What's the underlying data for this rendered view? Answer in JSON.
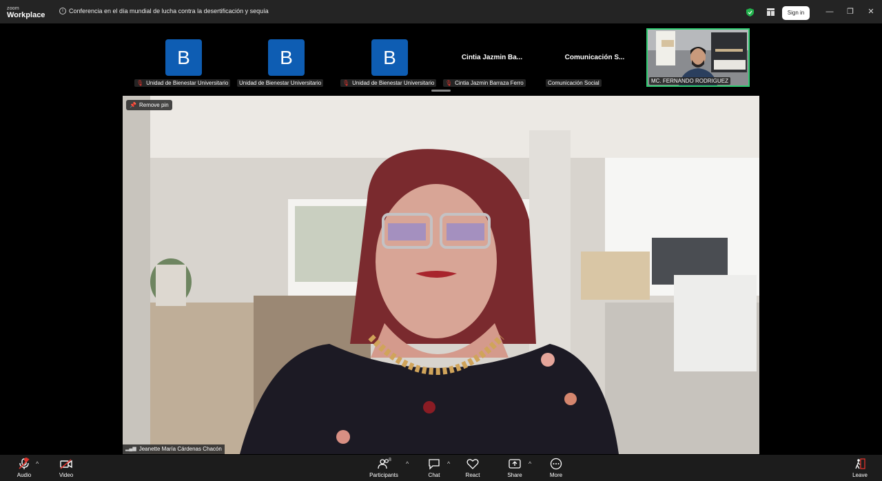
{
  "app": {
    "logo_line1": "zoom",
    "logo_line2": "Workplace"
  },
  "meeting": {
    "title": "Conferencia en el día mundial de lucha contra la desertificación y sequía"
  },
  "titlebar": {
    "signin_label": "Sign in",
    "minimize": "—",
    "restore": "❐",
    "close": "✕"
  },
  "strip": {
    "tiles": [
      {
        "avatar_letter": "B",
        "label": "Unidad de Bienestar Universitario"
      },
      {
        "avatar_letter": "B",
        "label": "Unidad de Bienestar Universitario"
      },
      {
        "avatar_letter": "B",
        "label": "Unidad de Bienestar Universitario"
      },
      {
        "name": "Cintia Jazmin Ba...",
        "label": "Cintia Jazmin Barraza Ferro"
      },
      {
        "name": "Comunicación S...",
        "label": "Comunicación Social"
      },
      {
        "label": "MC. FERNANDO RODRIGUEZ"
      }
    ]
  },
  "main_video": {
    "pin_label": "Remove pin",
    "speaker_name": "Jeanette María Cárdenas Chacón"
  },
  "toolbar": {
    "audio": "Audio",
    "video": "Video",
    "participants": "Participants",
    "participant_count": "8",
    "chat": "Chat",
    "react": "React",
    "share": "Share",
    "more": "More",
    "leave": "Leave"
  },
  "colors": {
    "avatar_bg": "#0e5db3",
    "active_speaker_border": "#2ecc71",
    "muted_red": "#e0342d"
  }
}
